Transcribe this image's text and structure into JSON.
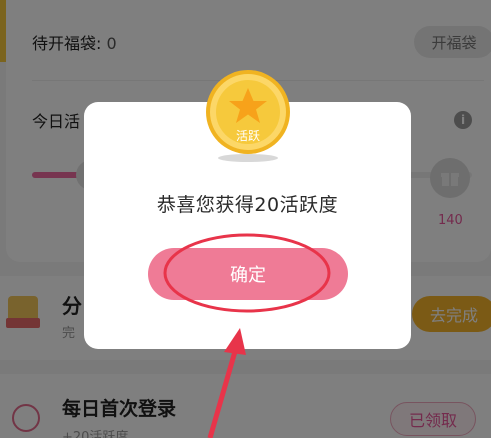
{
  "background": {
    "pending": {
      "label": "待开福袋: ",
      "count": "0",
      "button": "开福袋"
    },
    "activity": {
      "title": "今日活",
      "milestone": "140"
    },
    "tasks": [
      {
        "title": "分",
        "subtitle": "完",
        "button": "去完成"
      },
      {
        "title": "每日首次登录",
        "subtitle": "+20活跃度",
        "button": "已领取"
      }
    ]
  },
  "modal": {
    "coin_label": "活跃",
    "message": "恭喜您获得20活跃度",
    "confirm_label": "确定"
  },
  "colors": {
    "accent_pink": "#ef7b96",
    "coin_gold": "#f6c93c",
    "annotation_red": "#e8344a"
  },
  "icons": [
    "star-coin-icon",
    "info-icon",
    "gift-icon",
    "user-icon"
  ]
}
